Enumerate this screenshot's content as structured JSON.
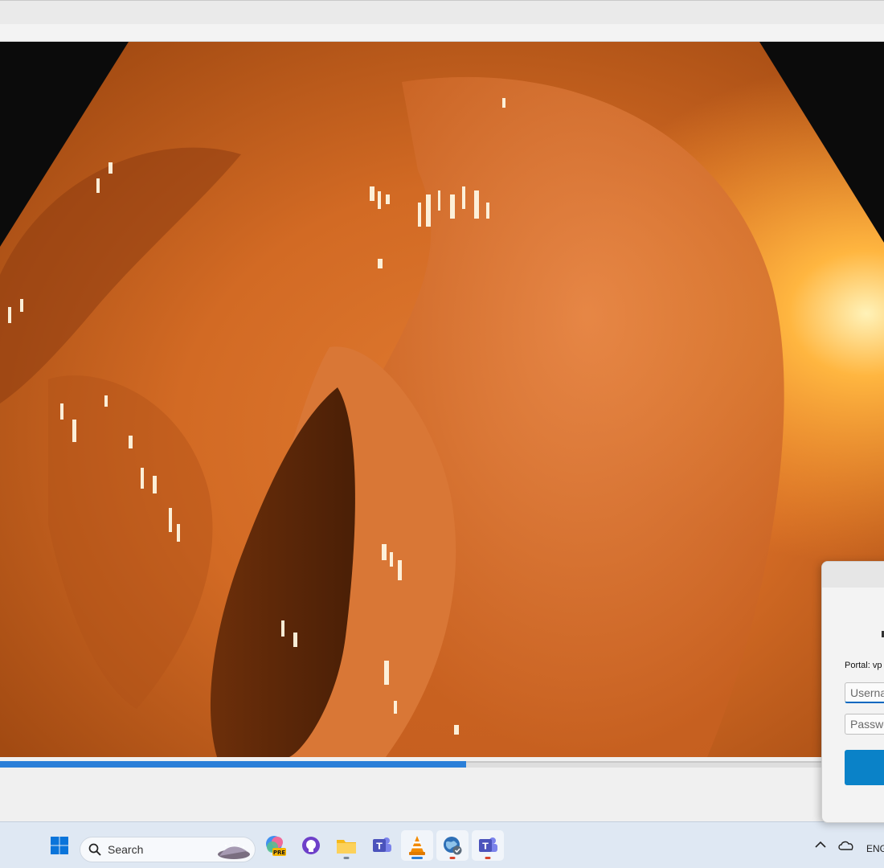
{
  "player": {
    "progress_fraction": 0.527
  },
  "taskbar": {
    "search_placeholder": "Search",
    "language_indicator": "ENG",
    "apps": [
      {
        "icon": "windows-start-icon"
      },
      {
        "icon": "copilot-pre-icon",
        "badge": "PRE"
      },
      {
        "icon": "github-icon"
      },
      {
        "icon": "file-explorer-icon"
      },
      {
        "icon": "teams-icon"
      },
      {
        "icon": "vlc-icon"
      },
      {
        "icon": "vpn-globe-icon"
      },
      {
        "icon": "teams-icon"
      }
    ],
    "colors": {
      "accent": "#2b7fd8",
      "notify": "#d9442b"
    }
  },
  "vpn_dialog": {
    "portal_label": "Portal: vp",
    "username_placeholder": "Userna",
    "password_placeholder": "Passwo",
    "button_color": "#0a82c8"
  }
}
